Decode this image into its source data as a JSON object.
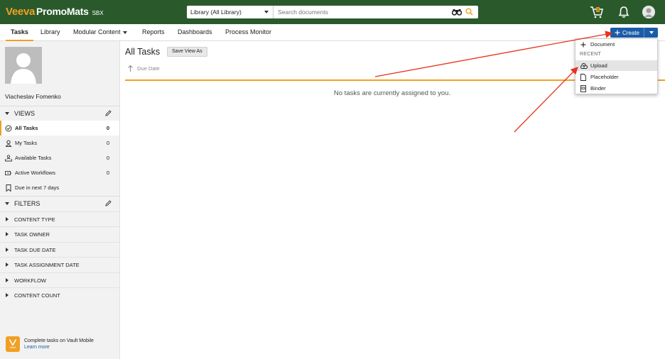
{
  "app": {
    "brand": "Veeva",
    "product": "PromoMats",
    "env": "SBX"
  },
  "search": {
    "scope": "Library (All Library)",
    "placeholder": "Search documents"
  },
  "header": {
    "cart_count": "0"
  },
  "nav": {
    "tabs": [
      {
        "label": "Tasks",
        "active": true
      },
      {
        "label": "Library"
      },
      {
        "label": "Modular Content"
      },
      {
        "label": "Reports"
      },
      {
        "label": "Dashboards"
      },
      {
        "label": "Process Monitor"
      }
    ],
    "create_label": "Create"
  },
  "create_menu": {
    "new_document": "Document",
    "recent_header": "RECENT",
    "items": [
      "Upload",
      "Placeholder",
      "Binder"
    ],
    "highlighted": "Upload"
  },
  "sidebar": {
    "user_name": "Viacheslav Fomenko",
    "views_header": "VIEWS",
    "views": [
      {
        "label": "All Tasks",
        "count": "0",
        "icon": "check-circle-icon",
        "active": true
      },
      {
        "label": "My Tasks",
        "count": "0",
        "icon": "person-icon"
      },
      {
        "label": "Available Tasks",
        "count": "0",
        "icon": "people-tray-icon"
      },
      {
        "label": "Active Workflows",
        "count": "0",
        "icon": "workflow-icon"
      },
      {
        "label": "Due in next 7 days",
        "count": "",
        "icon": "bookmark-icon"
      }
    ],
    "filters_header": "FILTERS",
    "filters": [
      "CONTENT TYPE",
      "TASK OWNER",
      "TASK DUE DATE",
      "TASK ASSIGNMENT DATE",
      "WORKFLOW",
      "CONTENT COUNT"
    ],
    "mobile_line1": "Complete tasks on Vault Mobile",
    "mobile_link": "Learn more",
    "mobile_logo_text": "Vault"
  },
  "main": {
    "title": "All Tasks",
    "save_view": "Save View As",
    "column": "Due Date",
    "empty_message": "No tasks are currently assigned to you."
  },
  "colors": {
    "header_bg": "#2a5a2c",
    "accent": "#f0a023",
    "primary": "#1a5ca8",
    "annotation": "#e8321e"
  }
}
